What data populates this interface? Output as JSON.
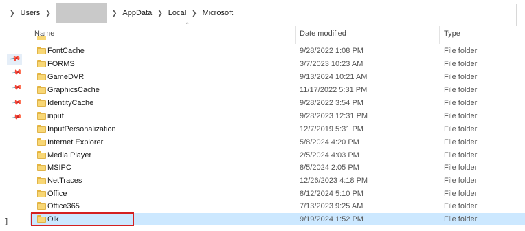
{
  "breadcrumb": {
    "items": [
      "Users",
      "AppData",
      "Local",
      "Microsoft"
    ]
  },
  "columns": {
    "name": "Name",
    "date_modified": "Date modified",
    "type": "Type"
  },
  "rows": [
    {
      "name": "FontCache",
      "date": "9/28/2022 1:08 PM",
      "type": "File folder"
    },
    {
      "name": "FORMS",
      "date": "3/7/2023 10:23 AM",
      "type": "File folder"
    },
    {
      "name": "GameDVR",
      "date": "9/13/2024 10:21 AM",
      "type": "File folder"
    },
    {
      "name": "GraphicsCache",
      "date": "11/17/2022 5:31 PM",
      "type": "File folder"
    },
    {
      "name": "IdentityCache",
      "date": "9/28/2022 3:54 PM",
      "type": "File folder"
    },
    {
      "name": "input",
      "date": "9/28/2023 12:31 PM",
      "type": "File folder"
    },
    {
      "name": "InputPersonalization",
      "date": "12/7/2019 5:31 PM",
      "type": "File folder"
    },
    {
      "name": "Internet Explorer",
      "date": "5/8/2024 4:20 PM",
      "type": "File folder"
    },
    {
      "name": "Media Player",
      "date": "2/5/2024 4:03 PM",
      "type": "File folder"
    },
    {
      "name": "MSIPC",
      "date": "8/5/2024 2:05 PM",
      "type": "File folder"
    },
    {
      "name": "NetTraces",
      "date": "12/26/2023 4:18 PM",
      "type": "File folder"
    },
    {
      "name": "Office",
      "date": "8/12/2024 5:10 PM",
      "type": "File folder"
    },
    {
      "name": "Office365",
      "date": "7/13/2023 9:25 AM",
      "type": "File folder"
    },
    {
      "name": "Olk",
      "date": "9/19/2024 1:52 PM",
      "type": "File folder",
      "selected": true
    }
  ],
  "icons": {
    "folder": "folder-icon",
    "pin": "pin-icon",
    "chevron": "chevron-right-icon",
    "sort": "sort-up-icon"
  },
  "colors": {
    "selection": "#cce8ff",
    "folder": "#f8d775",
    "highlight_box": "#d42020"
  }
}
